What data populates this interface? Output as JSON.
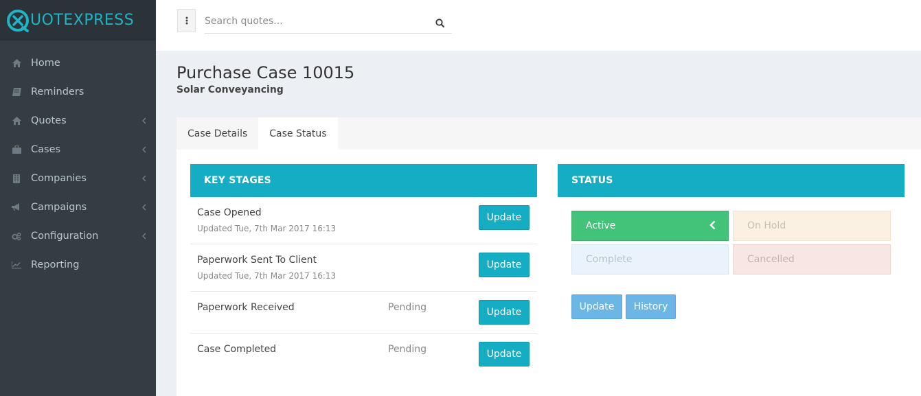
{
  "app": {
    "logo_text": "UOTEXPRESS",
    "brand_color": "#1fb4c6"
  },
  "sidebar": {
    "items": [
      {
        "label": "Home",
        "icon": "home-icon",
        "has_submenu": false
      },
      {
        "label": "Reminders",
        "icon": "book-icon",
        "has_submenu": false
      },
      {
        "label": "Quotes",
        "icon": "home-icon",
        "has_submenu": true
      },
      {
        "label": "Cases",
        "icon": "briefcase-icon",
        "has_submenu": true
      },
      {
        "label": "Companies",
        "icon": "building-icon",
        "has_submenu": true
      },
      {
        "label": "Campaigns",
        "icon": "bullhorn-icon",
        "has_submenu": true
      },
      {
        "label": "Configuration",
        "icon": "cogs-icon",
        "has_submenu": true
      },
      {
        "label": "Reporting",
        "icon": "line-chart-icon",
        "has_submenu": false
      }
    ]
  },
  "header": {
    "search": {
      "placeholder": "Search quotes...",
      "value": ""
    }
  },
  "page": {
    "title": "Purchase Case 10015",
    "subtitle": "Solar Conveyancing"
  },
  "tabs": [
    {
      "label": "Case Details",
      "active": false
    },
    {
      "label": "Case Status",
      "active": true
    }
  ],
  "key_stages": {
    "title": "KEY STAGES",
    "rows": [
      {
        "name": "Case Opened",
        "updated": "Updated Tue, 7th Mar 2017 16:13",
        "status": "",
        "button": "Update"
      },
      {
        "name": "Paperwork Sent To Client",
        "updated": "Updated Tue, 7th Mar 2017 16:13",
        "status": "",
        "button": "Update"
      },
      {
        "name": "Paperwork Received",
        "updated": "",
        "status": "Pending",
        "button": "Update"
      },
      {
        "name": "Case Completed",
        "updated": "",
        "status": "Pending",
        "button": "Update"
      }
    ]
  },
  "status": {
    "title": "STATUS",
    "options": [
      {
        "label": "Active",
        "selected": true,
        "color": "#43c27a"
      },
      {
        "label": "On Hold",
        "selected": false,
        "color": "#fbf1e3"
      },
      {
        "label": "Complete",
        "selected": false,
        "color": "#eaf3fb"
      },
      {
        "label": "Cancelled",
        "selected": false,
        "color": "#f8e6e4"
      }
    ],
    "update_label": "Update",
    "history_label": "History"
  },
  "colors": {
    "accent": "#15adc3",
    "sidebar_bg": "#353d43",
    "action_button": "#6cb6e5"
  }
}
